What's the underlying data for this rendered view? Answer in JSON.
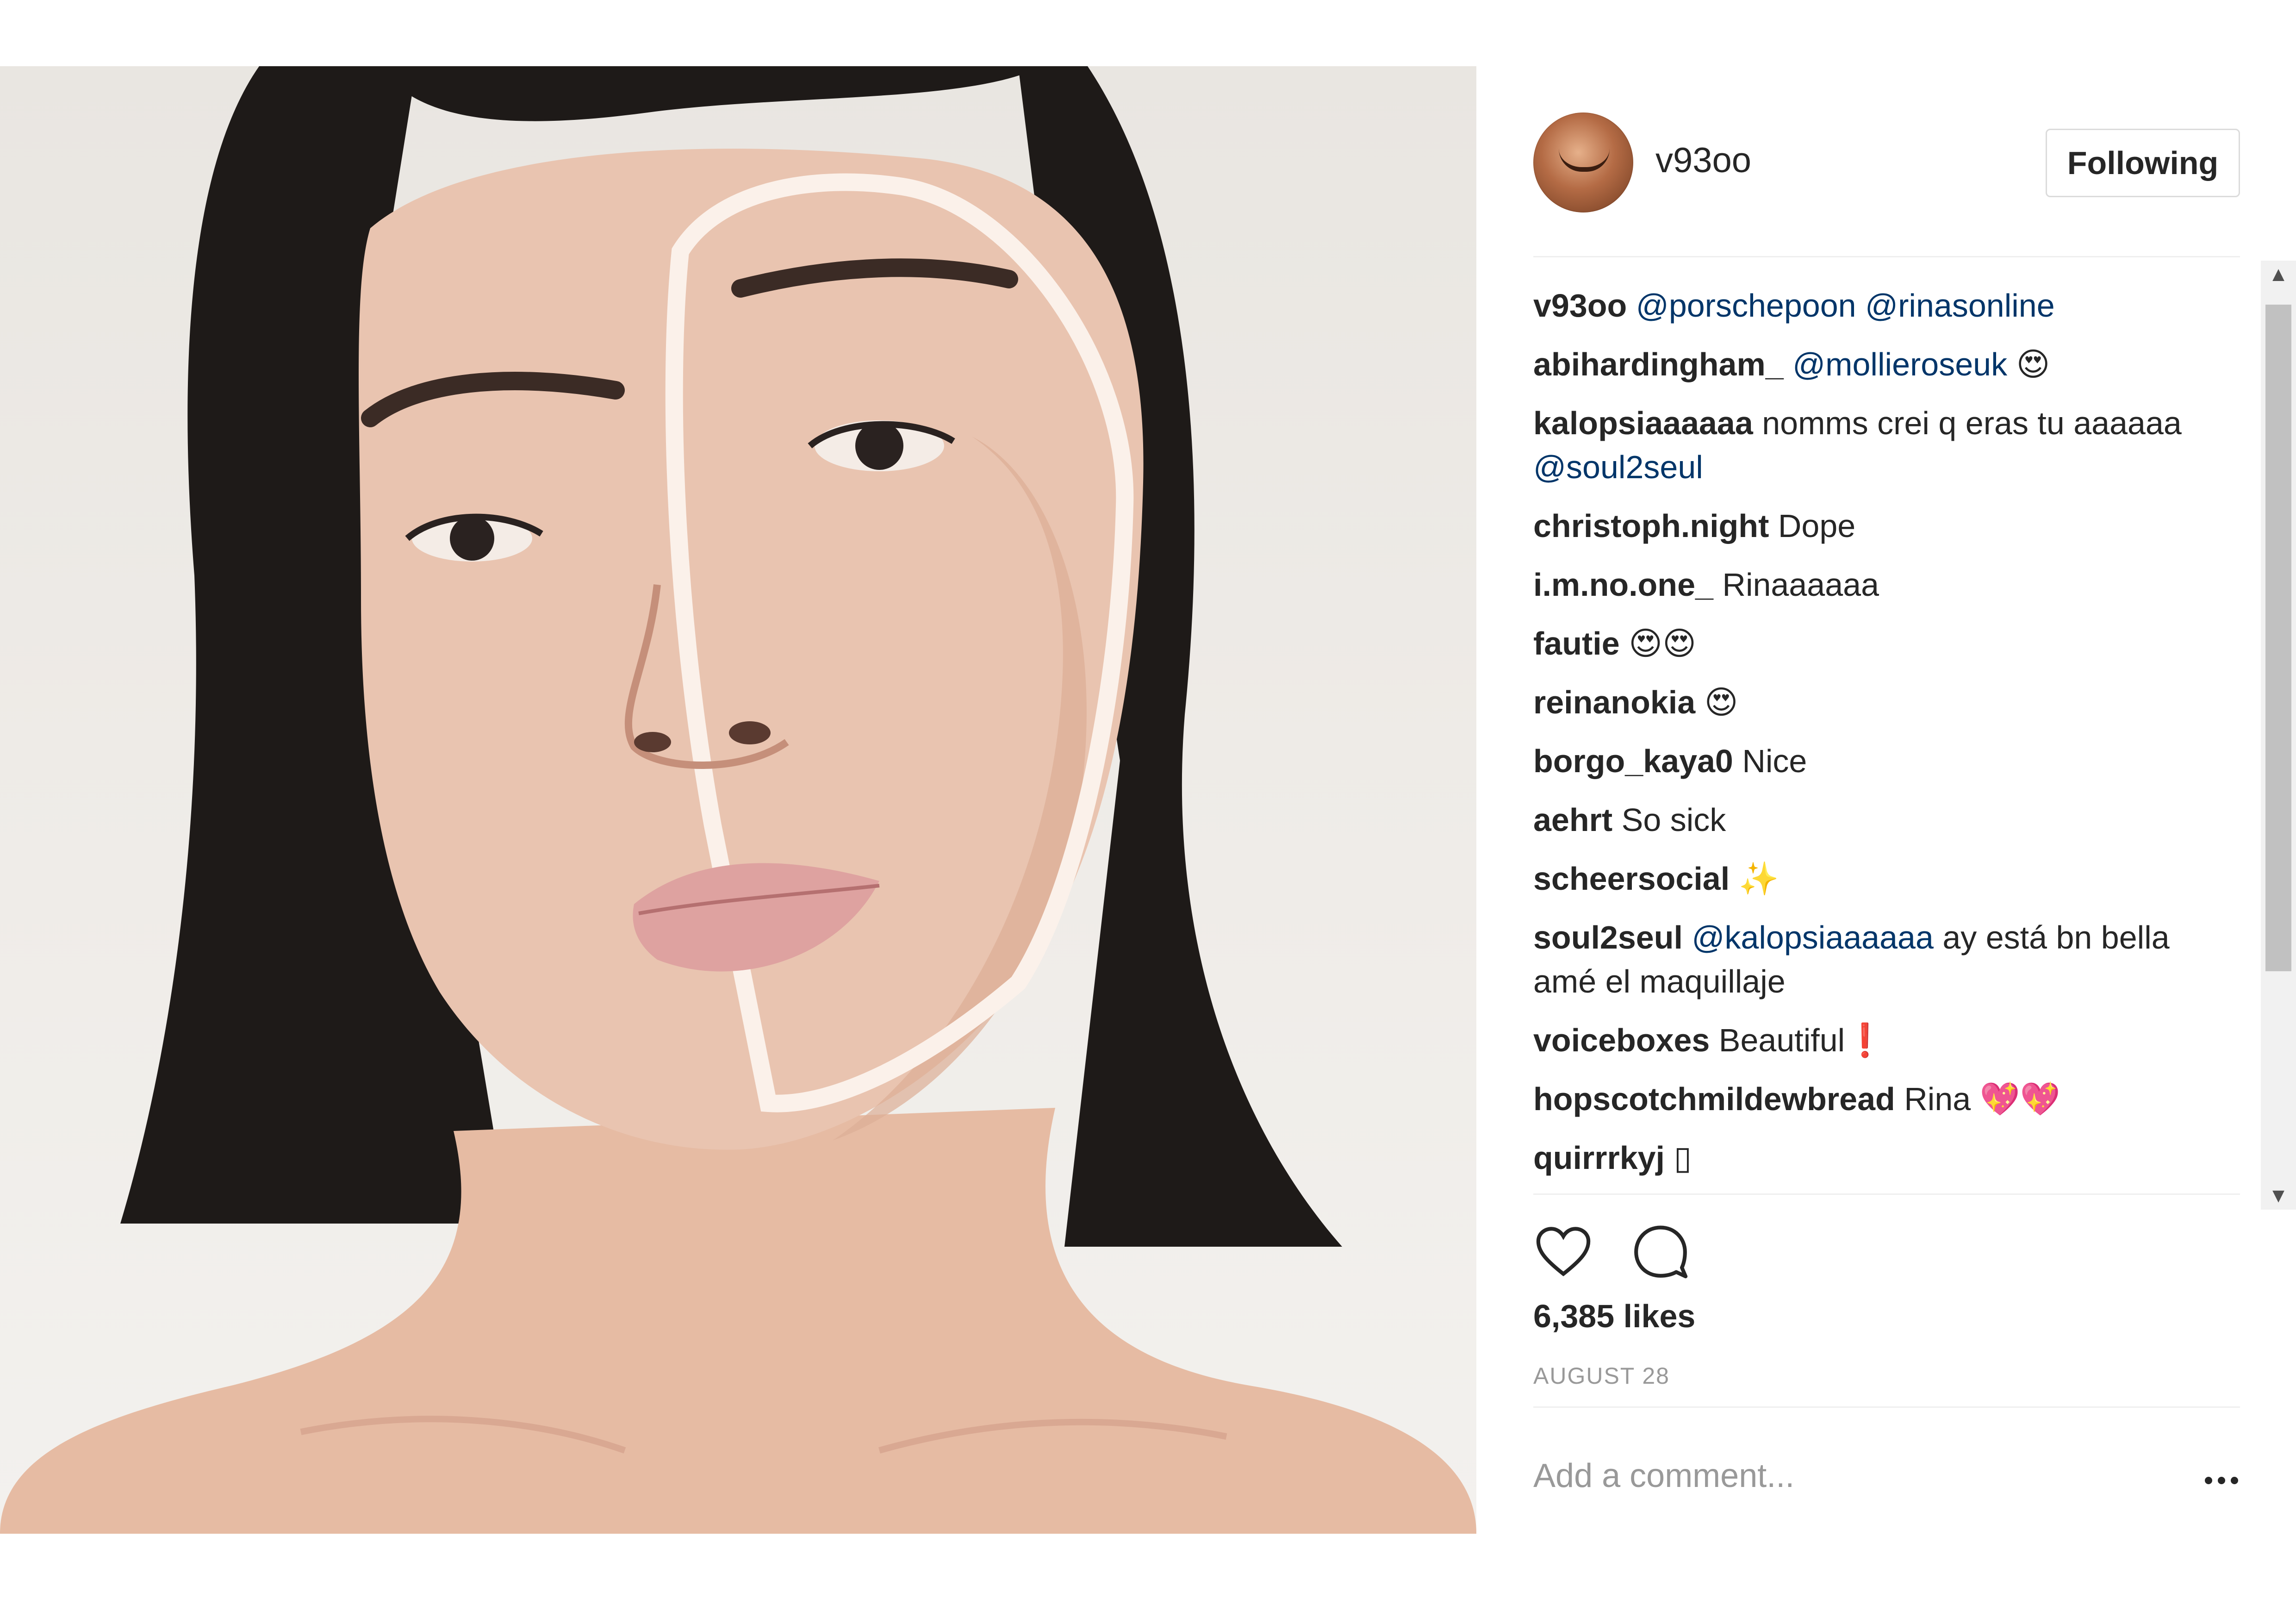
{
  "post": {
    "username": "v93oo",
    "follow_label": "Following",
    "likes": "6,385 likes",
    "date": "AUGUST 28",
    "comment_placeholder": "Add a comment..."
  },
  "comments": [
    {
      "user": "v93oo",
      "parts": [
        {
          "t": "mention",
          "v": "@porschepoon"
        },
        {
          "t": "text",
          "v": " "
        },
        {
          "t": "mention",
          "v": "@rinasonline"
        }
      ]
    },
    {
      "user": "abihardingham_",
      "parts": [
        {
          "t": "mention",
          "v": "@mollieroseuk"
        },
        {
          "t": "text",
          "v": " 😍"
        }
      ]
    },
    {
      "user": "kalopsiaaaaaa",
      "parts": [
        {
          "t": "text",
          "v": "nomms crei q eras tu aaaaaa "
        },
        {
          "t": "mention",
          "v": "@soul2seul"
        }
      ]
    },
    {
      "user": "christoph.night",
      "parts": [
        {
          "t": "text",
          "v": "Dope"
        }
      ]
    },
    {
      "user": "i.m.no.one_",
      "parts": [
        {
          "t": "text",
          "v": "Rinaaaaaa"
        }
      ]
    },
    {
      "user": "fautie",
      "parts": [
        {
          "t": "text",
          "v": "😍😍"
        }
      ]
    },
    {
      "user": "reinanokia",
      "parts": [
        {
          "t": "text",
          "v": "😍"
        }
      ]
    },
    {
      "user": "borgo_kaya0",
      "parts": [
        {
          "t": "text",
          "v": "Nice"
        }
      ]
    },
    {
      "user": "aehrt",
      "parts": [
        {
          "t": "text",
          "v": "So sick"
        }
      ]
    },
    {
      "user": "scheersocial",
      "parts": [
        {
          "t": "text",
          "v": "✨"
        }
      ]
    },
    {
      "user": "soul2seul",
      "parts": [
        {
          "t": "mention",
          "v": "@kalopsiaaaaaa"
        },
        {
          "t": "text",
          "v": " ay está bn bella amé el maquillaje"
        }
      ]
    },
    {
      "user": "voiceboxes",
      "parts": [
        {
          "t": "text",
          "v": "Beautiful❗"
        }
      ]
    },
    {
      "user": "hopscotchmildewbread",
      "parts": [
        {
          "t": "text",
          "v": "Rina 💖💖"
        }
      ]
    },
    {
      "user": "quirrrkyj",
      "parts": [
        {
          "t": "text",
          "v": "▯"
        }
      ]
    }
  ],
  "icons": {
    "like": "heart-icon",
    "comment": "comment-bubble-icon",
    "more": "more-options-icon",
    "scroll_up": "scroll-up-arrow-icon",
    "scroll_down": "scroll-down-arrow-icon"
  },
  "colors": {
    "text": "#262626",
    "mention": "#003569",
    "muted": "#999999",
    "divider": "#efefef",
    "button_border": "#dbdbdb"
  }
}
